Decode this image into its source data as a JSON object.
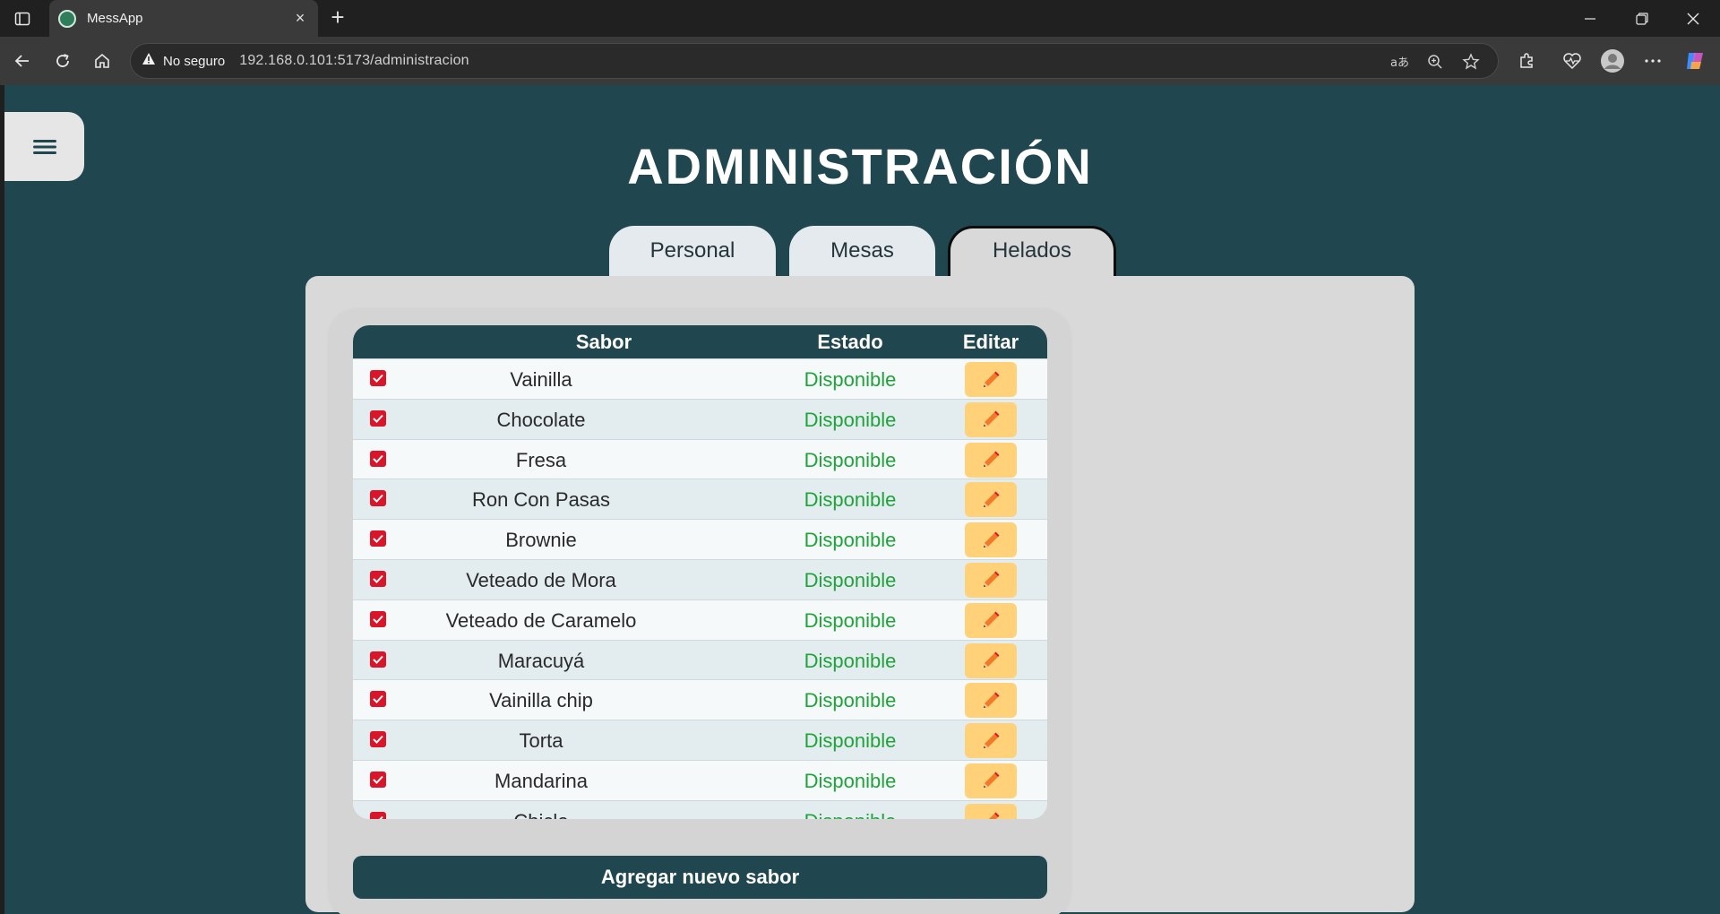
{
  "browser": {
    "tab_title": "MessApp",
    "tab_close": "×",
    "new_tab": "+",
    "security_label": "No seguro",
    "url": "192.168.0.101:5173/administracion",
    "accent": "#20474f"
  },
  "page": {
    "title": "ADMINISTRACIÓN",
    "tabs": [
      {
        "label": "Personal",
        "active": false
      },
      {
        "label": "Mesas",
        "active": false
      },
      {
        "label": "Helados",
        "active": true
      }
    ],
    "table": {
      "headers": {
        "sabor": "Sabor",
        "estado": "Estado",
        "editar": "Editar"
      },
      "rows": [
        {
          "checked": true,
          "sabor": "Vainilla",
          "estado": "Disponible"
        },
        {
          "checked": true,
          "sabor": "Chocolate",
          "estado": "Disponible"
        },
        {
          "checked": true,
          "sabor": "Fresa",
          "estado": "Disponible"
        },
        {
          "checked": true,
          "sabor": "Ron Con Pasas",
          "estado": "Disponible"
        },
        {
          "checked": true,
          "sabor": "Brownie",
          "estado": "Disponible"
        },
        {
          "checked": true,
          "sabor": "Veteado de Mora",
          "estado": "Disponible"
        },
        {
          "checked": true,
          "sabor": "Veteado de Caramelo",
          "estado": "Disponible"
        },
        {
          "checked": true,
          "sabor": "Maracuyá",
          "estado": "Disponible"
        },
        {
          "checked": true,
          "sabor": "Vainilla chip",
          "estado": "Disponible"
        },
        {
          "checked": true,
          "sabor": "Torta",
          "estado": "Disponible"
        },
        {
          "checked": true,
          "sabor": "Mandarina",
          "estado": "Disponible"
        },
        {
          "checked": true,
          "sabor": "Chicle",
          "estado": "Disponible"
        }
      ]
    },
    "add_button": "Agregar nuevo sabor",
    "colors": {
      "status_ok": "#1fa33a",
      "checkbox": "#d9152a",
      "edit_button": "#ffd27a"
    }
  }
}
